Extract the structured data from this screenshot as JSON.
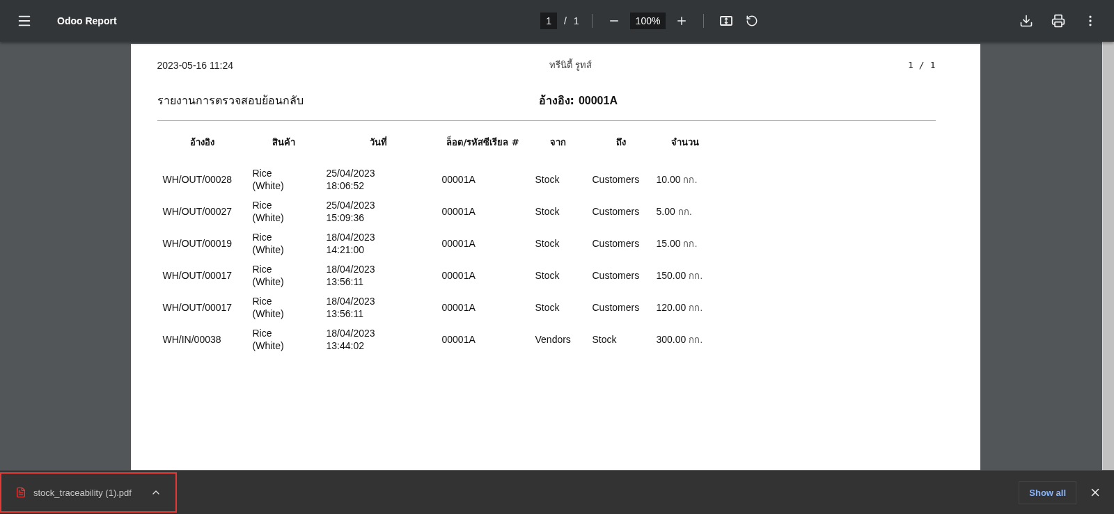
{
  "toolbar": {
    "title": "Odoo Report",
    "page_current": "1",
    "page_separator": "/",
    "page_total": "1",
    "zoom": "100%"
  },
  "report": {
    "printed_at": "2023-05-16 11:24",
    "company": "ทรีนิตี้ รูทส์",
    "page_current": "1",
    "page_separator": "/",
    "page_total": "1",
    "title": "รายงานการตรวจสอบย้อนกลับ",
    "reference_label": "อ้างอิง:",
    "reference_value": "00001A",
    "columns": [
      "อ้างอิง",
      "สินค้า",
      "วันที่",
      "ล็อต/รหัสซีเรียล #",
      "จาก",
      "ถึง",
      "จำนวน"
    ],
    "rows": [
      {
        "reference": "WH/OUT/00028",
        "product": [
          "Rice",
          "(White)"
        ],
        "date": [
          "25/04/2023",
          "18:06:52"
        ],
        "lot": "00001A",
        "from": "Stock",
        "to": "Customers",
        "quantity": "10.00",
        "unit": "กก."
      },
      {
        "reference": "WH/OUT/00027",
        "product": [
          "Rice",
          "(White)"
        ],
        "date": [
          "25/04/2023",
          "15:09:36"
        ],
        "lot": "00001A",
        "from": "Stock",
        "to": "Customers",
        "quantity": "5.00",
        "unit": "กก."
      },
      {
        "reference": "WH/OUT/00019",
        "product": [
          "Rice",
          "(White)"
        ],
        "date": [
          "18/04/2023",
          "14:21:00"
        ],
        "lot": "00001A",
        "from": "Stock",
        "to": "Customers",
        "quantity": "15.00",
        "unit": "กก."
      },
      {
        "reference": "WH/OUT/00017",
        "product": [
          "Rice",
          "(White)"
        ],
        "date": [
          "18/04/2023",
          "13:56:11"
        ],
        "lot": "00001A",
        "from": "Stock",
        "to": "Customers",
        "quantity": "150.00",
        "unit": "กก."
      },
      {
        "reference": "WH/OUT/00017",
        "product": [
          "Rice",
          "(White)"
        ],
        "date": [
          "18/04/2023",
          "13:56:11"
        ],
        "lot": "00001A",
        "from": "Stock",
        "to": "Customers",
        "quantity": "120.00",
        "unit": "กก."
      },
      {
        "reference": "WH/IN/00038",
        "product": [
          "Rice",
          "(White)"
        ],
        "date": [
          "18/04/2023",
          "13:44:02"
        ],
        "lot": "00001A",
        "from": "Vendors",
        "to": "Stock",
        "quantity": "300.00",
        "unit": "กก."
      }
    ]
  },
  "download_bar": {
    "file_name": "stock_traceability (1).pdf",
    "show_all": "Show all"
  }
}
